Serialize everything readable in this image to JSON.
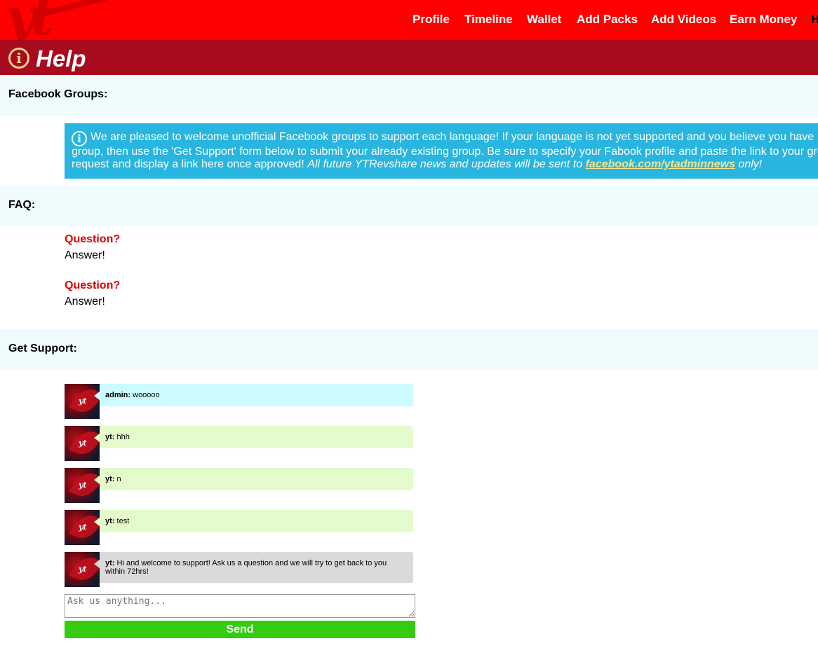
{
  "header": {
    "logo_text": "yt",
    "nav": [
      "Profile",
      "Timeline",
      "Wallet",
      "Add Packs",
      "Add Videos",
      "Earn Money",
      "H"
    ]
  },
  "help_bar": {
    "icon": "info-icon",
    "title": "Help"
  },
  "sections": {
    "facebook_title": "Facebook Groups:",
    "faq_title": "FAQ:",
    "support_title": "Get Support:"
  },
  "facebook_notice": {
    "icon": "info-icon",
    "line1": "We are pleased to welcome unofficial Facebook groups to support each language! If your language is not yet supported and you believe you have",
    "line2": "group, then use the 'Get Support' form below to submit your already existing group. Be sure to specify your Fabook profile and paste the link to your gro",
    "line3_plain": "request and display a link here once approved! ",
    "line3_italic": "All future YTRevshare news and updates will be sent to ",
    "link_text": "facebook.com/ytadminnews",
    "line3_tail": " only!"
  },
  "faq": [
    {
      "question": "Question?",
      "answer": "Answer!"
    },
    {
      "question": "Question?",
      "answer": "Answer!"
    }
  ],
  "messages": [
    {
      "sender": "admin:",
      "text": "wooooo",
      "color": "#ccfcff"
    },
    {
      "sender": "yt:",
      "text": "hhh",
      "color": "#e4fccc"
    },
    {
      "sender": "yt:",
      "text": "n",
      "color": "#e4fccc"
    },
    {
      "sender": "yt:",
      "text": "test",
      "color": "#e4fccc"
    },
    {
      "sender": "yt:",
      "text": "Hi and welcome to support! Ask us a question and we will try to get back to you within 72hrs!",
      "color": "#dadada"
    }
  ],
  "support_form": {
    "placeholder": "Ask us anything...",
    "send_label": "Send"
  },
  "colors": {
    "header_bg": "#ff0000",
    "help_bar_bg": "#a80a1e",
    "notice_bg": "#28b5e0",
    "question_color": "#e00000",
    "send_button": "#33cc11"
  }
}
